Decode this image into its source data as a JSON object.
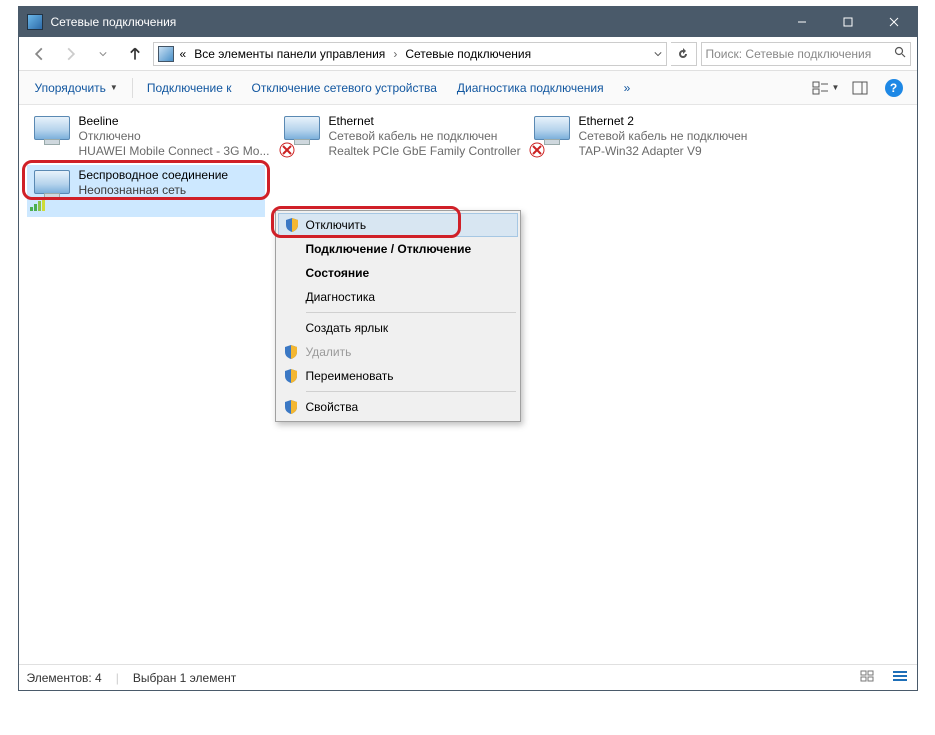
{
  "window": {
    "title": "Сетевые подключения"
  },
  "breadcrumb": {
    "prefix": "«",
    "seg1": "Все элементы панели управления",
    "seg2": "Сетевые подключения"
  },
  "search": {
    "placeholder": "Поиск: Сетевые подключения"
  },
  "toolbar": {
    "organize": "Упорядочить",
    "connect": "Подключение к",
    "disable": "Отключение сетевого устройства",
    "diag": "Диагностика подключения",
    "more": "»"
  },
  "items": [
    {
      "name": "Beeline",
      "status": "Отключено",
      "adapter": "HUAWEI Mobile Connect - 3G Mo..."
    },
    {
      "name": "Ethernet",
      "status": "Сетевой кабель не подключен",
      "adapter": "Realtek PCIe GbE Family Controller"
    },
    {
      "name": "Ethernet 2",
      "status": "Сетевой кабель не подключен",
      "adapter": "TAP-Win32 Adapter V9"
    },
    {
      "name": "Беспроводное соединение",
      "status": "Неопознанная сеть",
      "adapter": ""
    }
  ],
  "menu": {
    "disable": "Отключить",
    "connect": "Подключение / Отключение",
    "status": "Состояние",
    "diag": "Диагностика",
    "shortcut": "Создать ярлык",
    "delete": "Удалить",
    "rename": "Переименовать",
    "props": "Свойства"
  },
  "statusbar": {
    "count": "Элементов: 4",
    "selected": "Выбран 1 элемент"
  }
}
